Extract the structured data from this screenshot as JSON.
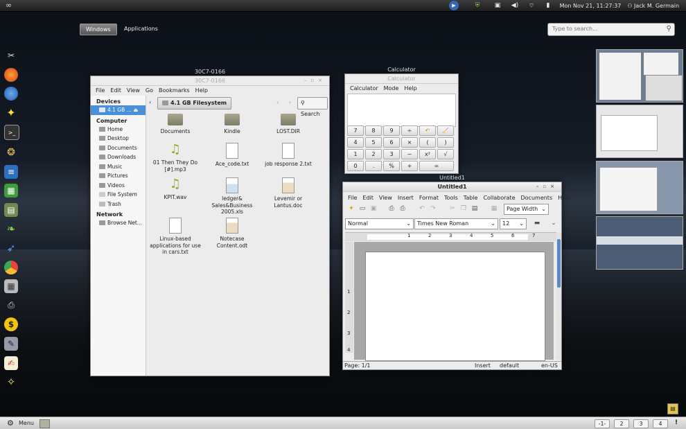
{
  "top_panel": {
    "activities_icon": "infinity-icon",
    "clock": "Mon Nov 21, 11:27:37",
    "user": "Jack M. Germain",
    "tray_icons": [
      "media-player-icon",
      "shield-icon",
      "display-icon",
      "volume-icon",
      "wifi-icon",
      "battery-icon",
      "user-icon"
    ]
  },
  "overview": {
    "tabs": [
      "Windows",
      "Applications"
    ],
    "search_placeholder": "Type to search..."
  },
  "dock": {
    "icons": [
      "tools-icon",
      "firefox-icon",
      "thunderbird-icon",
      "star-icon",
      "terminal-icon",
      "gimp-icon",
      "writer-icon",
      "calc-spreadsheet-icon",
      "calculator-icon",
      "leaf-icon",
      "bird-icon",
      "chrome-icon",
      "grid-icon",
      "printer-icon",
      "dollar-icon",
      "pen-icon",
      "notepad-icon",
      "sparkle-icon"
    ]
  },
  "file_manager": {
    "caption": "30C7-0166",
    "title": "30C7-0166",
    "menu": [
      "File",
      "Edit",
      "View",
      "Go",
      "Bookmarks",
      "Help"
    ],
    "sidebar": {
      "devices_header": "Devices",
      "devices": [
        "4.1 GB ..."
      ],
      "computer_header": "Computer",
      "computer": [
        "Home",
        "Desktop",
        "Documents",
        "Downloads",
        "Music",
        "Pictures",
        "Videos",
        "File System",
        "Trash"
      ],
      "network_header": "Network",
      "network": [
        "Browse Net..."
      ]
    },
    "path_label": "4.1 GB Filesystem",
    "search_label": "Search",
    "files": [
      {
        "name": "Documents",
        "type": "folder"
      },
      {
        "name": "Kindle",
        "type": "folder"
      },
      {
        "name": "LOST.DIR",
        "type": "folder"
      },
      {
        "name": "01 Then They Do [#].mp3",
        "type": "audio"
      },
      {
        "name": "Ace_code.txt",
        "type": "text"
      },
      {
        "name": "job response 2.txt",
        "type": "text"
      },
      {
        "name": "KPIT.wav",
        "type": "audio"
      },
      {
        "name": "ledger& Sales&Business 2005.xls",
        "type": "sheet"
      },
      {
        "name": "Levemir or Lantus.doc",
        "type": "doc"
      },
      {
        "name": "Linux-based applications for use in cars.txt",
        "type": "text"
      },
      {
        "name": "Notecase Content.odt",
        "type": "doc"
      }
    ]
  },
  "calculator": {
    "caption": "Calculator",
    "title": "Calculator",
    "menu": [
      "Calculator",
      "Mode",
      "Help"
    ],
    "keys": [
      "7",
      "8",
      "9",
      "÷",
      "↶",
      "🧹",
      "4",
      "5",
      "6",
      "×",
      "(",
      ")",
      "1",
      "2",
      "3",
      "−",
      "x²",
      "√",
      "0",
      ".",
      "%",
      "+",
      "="
    ]
  },
  "writer": {
    "caption": "Untitled1",
    "title": "Untitled1",
    "menu": [
      "File",
      "Edit",
      "View",
      "Insert",
      "Format",
      "Tools",
      "Table",
      "Collaborate",
      "Documents",
      "Help"
    ],
    "zoom": "Page Width",
    "style": "Normal",
    "font": "Times New Roman",
    "size": "12",
    "ruler_numbers": [
      "1",
      "2",
      "3",
      "4",
      "5",
      "6",
      "7"
    ],
    "vruler_numbers": [
      "1",
      "2",
      "3",
      "4"
    ],
    "status": {
      "page": "Page: 1/1",
      "mode": "Insert",
      "style": "default",
      "lang": "en-US"
    }
  },
  "bottom_panel": {
    "menu_label": "Menu",
    "workspaces": [
      "-1-",
      "2",
      "3",
      "4"
    ],
    "notify": "!"
  }
}
